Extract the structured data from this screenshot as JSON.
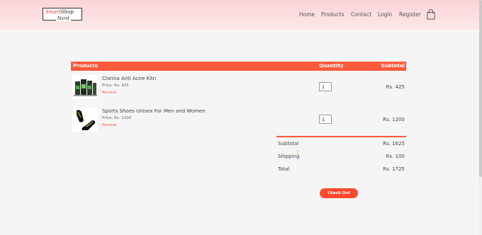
{
  "brand": {
    "logo_line1_a": "Smart",
    "logo_line1_b": "Shop",
    "logo_line2": "Nerd"
  },
  "nav": {
    "items": [
      "Home",
      "Products",
      "Contact",
      "Login",
      "Register"
    ],
    "cart_icon": "shopping-bag-icon"
  },
  "table": {
    "headers": {
      "products": "Products",
      "quantity": "Quantity",
      "subtotal": "Subtotal"
    },
    "rows": [
      {
        "name": "Clarina Anti Acne Kitn",
        "price": "Price: Rs. 425",
        "remove": "Remove",
        "quantity": "1",
        "subtotal": "Rs. 425",
        "image_icon": "skincare-product-image"
      },
      {
        "name": "Sports Shoes Unisex For Men and Women",
        "price": "Price: Rs. 1200",
        "remove": "Remove",
        "quantity": "1",
        "subtotal": "Rs. 1200",
        "image_icon": "shoes-product-image"
      }
    ]
  },
  "totals": {
    "subtotal_label": "Subtotal",
    "subtotal_value": "Rs. 1625",
    "shipping_label": "Shipping",
    "shipping_value": "Rs. 100",
    "total_label": "Total",
    "total_value": "Rs. 1725"
  },
  "checkout_label": "Check Out",
  "colors": {
    "accent": "#ff5a3c",
    "header_bg": "#fbd3d6",
    "page_bg": "#f5f5f5"
  }
}
